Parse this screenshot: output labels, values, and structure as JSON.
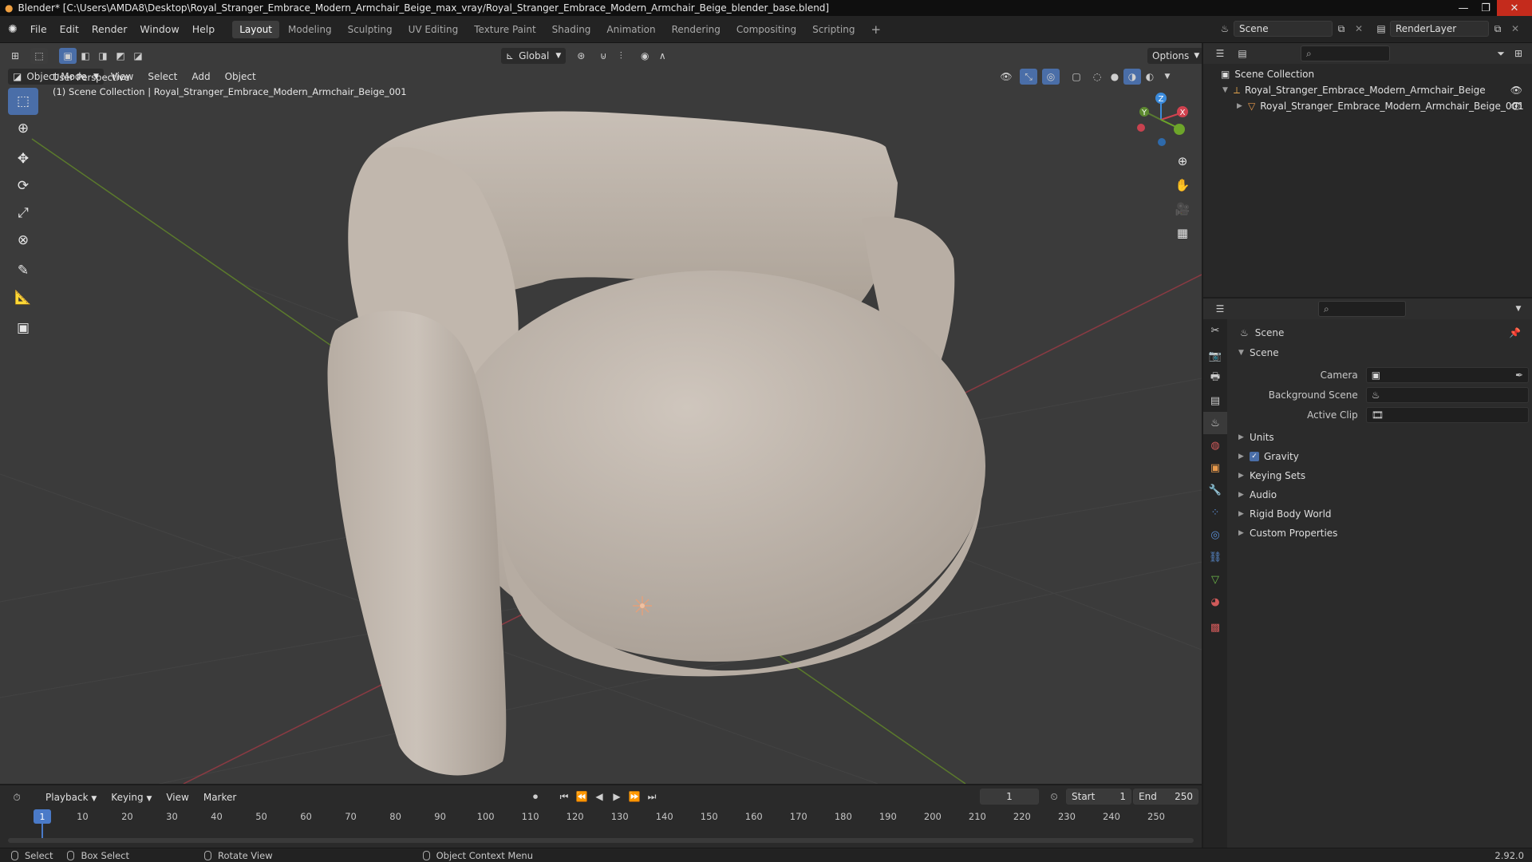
{
  "titlebar": {
    "text": "Blender* [C:\\Users\\AMDA8\\Desktop\\Royal_Stranger_Embrace_Modern_Armchair_Beige_max_vray/Royal_Stranger_Embrace_Modern_Armchair_Beige_blender_base.blend]"
  },
  "menu": [
    "File",
    "Edit",
    "Render",
    "Window",
    "Help"
  ],
  "workspaces": [
    "Layout",
    "Modeling",
    "Sculpting",
    "UV Editing",
    "Texture Paint",
    "Shading",
    "Animation",
    "Rendering",
    "Compositing",
    "Scripting"
  ],
  "active_workspace": "Layout",
  "scene_selector": {
    "value": "Scene"
  },
  "renderlayer_selector": {
    "value": "RenderLayer"
  },
  "viewport": {
    "transform_orientation": "Global",
    "options_label": "Options",
    "mode": "Object Mode",
    "menus": [
      "View",
      "Select",
      "Add",
      "Object"
    ],
    "overlay_line1": "User Perspective",
    "overlay_line2": "(1) Scene Collection | Royal_Stranger_Embrace_Modern_Armchair_Beige_001",
    "gizmo": {
      "x": "X",
      "y": "Y",
      "z": "Z"
    }
  },
  "outliner": {
    "root": "Scene Collection",
    "items": [
      {
        "label": "Royal_Stranger_Embrace_Modern_Armchair_Beige"
      },
      {
        "label": "Royal_Stranger_Embrace_Modern_Armchair_Beige_001"
      }
    ]
  },
  "properties": {
    "context_title": "Scene",
    "panel_title": "Scene",
    "fields": [
      {
        "label": "Camera",
        "value": ""
      },
      {
        "label": "Background Scene",
        "value": ""
      },
      {
        "label": "Active Clip",
        "value": ""
      }
    ],
    "subpanels": [
      "Units",
      "Gravity",
      "Keying Sets",
      "Audio",
      "Rigid Body World",
      "Custom Properties"
    ],
    "gravity_checked": true
  },
  "timeline": {
    "menus": [
      "Playback",
      "Keying",
      "View",
      "Marker"
    ],
    "current_frame": "1",
    "start_label": "Start",
    "start_value": "1",
    "end_label": "End",
    "end_value": "250",
    "ticks": [
      "1",
      "10",
      "20",
      "30",
      "40",
      "50",
      "60",
      "70",
      "80",
      "90",
      "100",
      "110",
      "120",
      "130",
      "140",
      "150",
      "160",
      "170",
      "180",
      "190",
      "200",
      "210",
      "220",
      "230",
      "240",
      "250"
    ]
  },
  "statusbar": {
    "select": "Select",
    "box_select": "Box Select",
    "rotate_view": "Rotate View",
    "context_menu": "Object Context Menu",
    "version": "2.92.0"
  },
  "colors": {
    "accent": "#4a6ea8",
    "axis_x": "#d0424f",
    "axis_y": "#6da52a",
    "axis_z": "#3b8bdc",
    "chair": "#c2b8ae"
  }
}
